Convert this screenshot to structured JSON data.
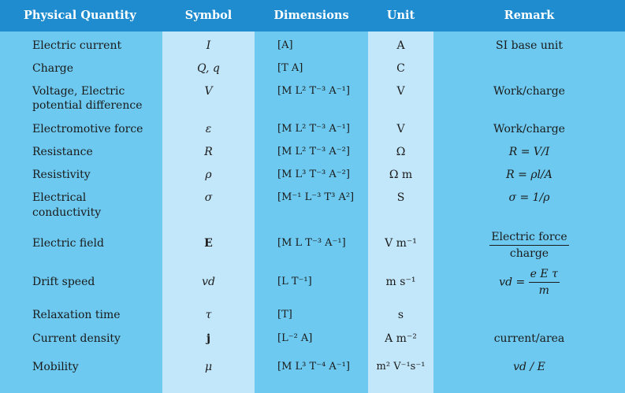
{
  "colors": {
    "header": "#1f8ccf",
    "band_dark": "#6dc9ef",
    "band_light": "#c3e7fa"
  },
  "headers": {
    "quantity": "Physical Quantity",
    "symbol": "Symbol",
    "dimensions": "Dimensions",
    "unit": "Unit",
    "remark": "Remark"
  },
  "rows": [
    {
      "quantity": "Electric current",
      "symbol": "I",
      "dimensions": "[A]",
      "unit": "A",
      "remark": "SI base unit"
    },
    {
      "quantity": "Charge",
      "symbol": "Q, q",
      "dimensions": "[T A]",
      "unit": "C",
      "remark": ""
    },
    {
      "quantity": "Voltage, Electric",
      "quantity2": "potential difference",
      "symbol": "V",
      "dimensions": "[M L² T⁻³ A⁻¹]",
      "unit": "V",
      "remark": "Work/charge"
    },
    {
      "quantity": "Electromotive force",
      "symbol": "ε",
      "dimensions": "[M L² T⁻³ A⁻¹]",
      "unit": "V",
      "remark": "Work/charge"
    },
    {
      "quantity": "Resistance",
      "symbol": "R",
      "dimensions": "[M L² T⁻³ A⁻²]",
      "unit": "Ω",
      "remark": "R = V/I"
    },
    {
      "quantity": "Resistivity",
      "symbol": "ρ",
      "dimensions": "[M L³ T⁻³ A⁻²]",
      "unit": "Ω m",
      "remark": "R = ρl/A"
    },
    {
      "quantity": "Electrical",
      "quantity2": "conductivity",
      "symbol": "σ",
      "dimensions": "[M⁻¹ L⁻³ T³ A²]",
      "unit": "S",
      "remark": "σ = 1/ρ"
    },
    {
      "quantity": "Electric field",
      "symbol": "E",
      "dimensions": "[M L T⁻³ A⁻¹]",
      "unit": "V m⁻¹",
      "remark_num": "Electric force",
      "remark_den": "charge"
    },
    {
      "quantity": "Drift speed",
      "symbol": "vd",
      "dimensions": "[L T⁻¹]",
      "unit": "m s⁻¹",
      "remark_lhs": "vd =",
      "remark_num": "e E τ",
      "remark_den": "m"
    },
    {
      "quantity": "Relaxation time",
      "symbol": "τ",
      "dimensions": "[T]",
      "unit": "s",
      "remark": ""
    },
    {
      "quantity": "Current density",
      "symbol": "j",
      "dimensions": "[L⁻² A]",
      "unit": "A m⁻²",
      "remark": "current/area"
    },
    {
      "quantity": "Mobility",
      "symbol": "μ",
      "dimensions": "[M L³ T⁻⁴ A⁻¹]",
      "unit": "m² V⁻¹s⁻¹",
      "remark": "vd / E"
    }
  ]
}
